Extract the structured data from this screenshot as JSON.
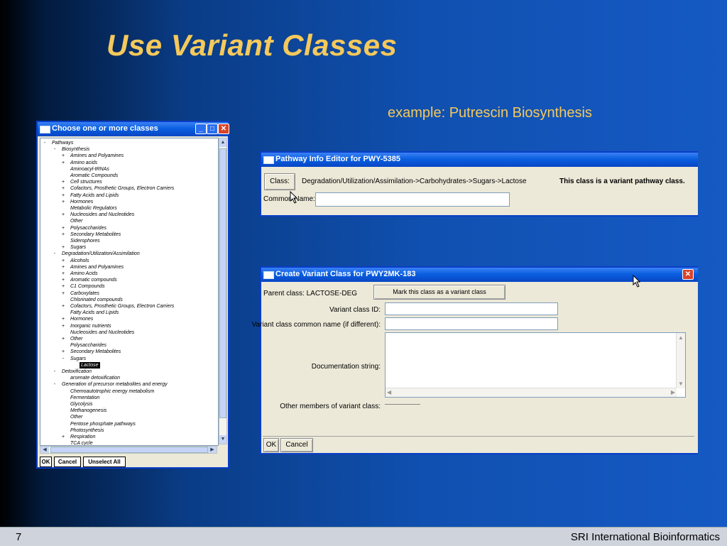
{
  "slide": {
    "title": "Use Variant Classes",
    "subtitle": "example: Putrescin Biosynthesis",
    "page_number": "7",
    "organization": "SRI International Bioinformatics"
  },
  "chooser": {
    "title": "Choose one or more classes",
    "tree": [
      {
        "pm": "-",
        "label": "Pathways",
        "level": 0
      },
      {
        "pm": "-",
        "label": "Biosynthesis",
        "level": 1
      },
      {
        "pm": "+",
        "label": "Amines and Polyamines",
        "level": 2
      },
      {
        "pm": "+",
        "label": "Amino acids",
        "level": 2
      },
      {
        "pm": "",
        "label": "Aminoacyl-tRNAs",
        "level": 2
      },
      {
        "pm": "",
        "label": "Aromatic Compounds",
        "level": 2
      },
      {
        "pm": "+",
        "label": "Cell structures",
        "level": 2
      },
      {
        "pm": "+",
        "label": "Cofactors, Prosthetic Groups, Electron Carriers",
        "level": 2
      },
      {
        "pm": "+",
        "label": "Fatty Acids and Lipids",
        "level": 2
      },
      {
        "pm": "+",
        "label": "Hormones",
        "level": 2
      },
      {
        "pm": "",
        "label": "Metabolic Regulators",
        "level": 2
      },
      {
        "pm": "+",
        "label": "Nucleosides and Nucleotides",
        "level": 2
      },
      {
        "pm": "",
        "label": "Other",
        "level": 2
      },
      {
        "pm": "+",
        "label": "Polysaccharides",
        "level": 2
      },
      {
        "pm": "+",
        "label": "Secondary Metabolites",
        "level": 2
      },
      {
        "pm": "",
        "label": "Siderophores",
        "level": 2
      },
      {
        "pm": "+",
        "label": "Sugars",
        "level": 2
      },
      {
        "pm": "-",
        "label": "Degradation/Utilization/Assimilation",
        "level": 1
      },
      {
        "pm": "+",
        "label": "Alcohols",
        "level": 2
      },
      {
        "pm": "+",
        "label": "Amines and Polyamines",
        "level": 2
      },
      {
        "pm": "+",
        "label": "Amino Acids",
        "level": 2
      },
      {
        "pm": "+",
        "label": "Aromatic compounds",
        "level": 2
      },
      {
        "pm": "+",
        "label": "C1 Compounds",
        "level": 2
      },
      {
        "pm": "+",
        "label": "Carboxylates",
        "level": 2
      },
      {
        "pm": "",
        "label": "Chlorinated compounds",
        "level": 2
      },
      {
        "pm": "+",
        "label": "Cofactors, Prosthetic Groups, Electron Carriers",
        "level": 2
      },
      {
        "pm": "",
        "label": "Fatty Acids and Lipids",
        "level": 2
      },
      {
        "pm": "+",
        "label": "Hormones",
        "level": 2
      },
      {
        "pm": "+",
        "label": "Inorganic nutrients",
        "level": 2
      },
      {
        "pm": "",
        "label": "Nucleosides and Nucleotides",
        "level": 2
      },
      {
        "pm": "+",
        "label": "Other",
        "level": 2
      },
      {
        "pm": "",
        "label": "Polysaccharides",
        "level": 2
      },
      {
        "pm": "+",
        "label": "Secondary Metabolites",
        "level": 2
      },
      {
        "pm": "-",
        "label": "Sugars",
        "level": 2
      },
      {
        "pm": "",
        "label": "Lactose",
        "level": 3,
        "selected": true
      },
      {
        "pm": "-",
        "label": "Detoxification",
        "level": 1
      },
      {
        "pm": "",
        "label": "arsenate detoxification",
        "level": 2
      },
      {
        "pm": "-",
        "label": "Generation of precursor metabolites and energy",
        "level": 1
      },
      {
        "pm": "",
        "label": "Chemoautotrophic energy metabolism",
        "level": 2
      },
      {
        "pm": "",
        "label": "Fermentation",
        "level": 2
      },
      {
        "pm": "",
        "label": "Glycolysis",
        "level": 2
      },
      {
        "pm": "",
        "label": "Methanogenesis",
        "level": 2
      },
      {
        "pm": "",
        "label": "Other",
        "level": 2
      },
      {
        "pm": "",
        "label": "Pentose phosphate pathways",
        "level": 2
      },
      {
        "pm": "",
        "label": "Photosynthesis",
        "level": 2
      },
      {
        "pm": "+",
        "label": "Respiration",
        "level": 2
      },
      {
        "pm": "",
        "label": "TCA cycle",
        "level": 2
      }
    ],
    "buttons": {
      "ok": "OK",
      "cancel": "Cancel",
      "unselect_all": "Unselect All"
    }
  },
  "pathway_editor": {
    "title": "Pathway Info Editor for PWY-5385",
    "class_button": "Class:",
    "class_path": "Degradation/Utilization/Assimilation->Carbohydrates->Sugars->Lactose",
    "variant_notice": "This class is a variant pathway class.",
    "common_name_label": "Common Name:",
    "common_name_value": ""
  },
  "variant_dialog": {
    "title": "Create Variant Class for PWY2MK-183",
    "parent_class_label": "Parent class: LACTOSE-DEG",
    "mark_button": "Mark this class as a variant class",
    "variant_id_label": "Variant class ID:",
    "variant_id_value": "",
    "common_name_label": "Variant class common name (if different):",
    "common_name_value": "",
    "doc_label": "Documentation string:",
    "doc_value": "",
    "other_members_label": "Other members of variant class:",
    "buttons": {
      "ok": "OK",
      "cancel": "Cancel"
    }
  },
  "colors": {
    "title": "#f5c95a",
    "titlebar": "#0a5fe0",
    "dialog_bg": "#ece9d8"
  },
  "icons": [
    "window-icon",
    "minimize-icon",
    "maximize-icon",
    "close-icon",
    "mouse-cursor-icon",
    "scroll-arrow-icon"
  ]
}
